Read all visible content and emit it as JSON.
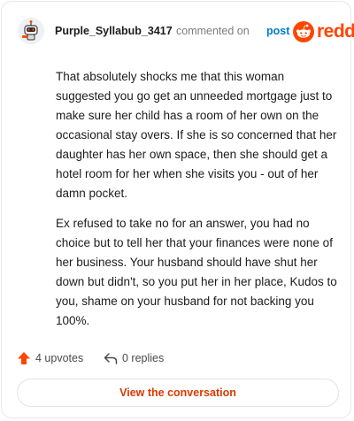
{
  "comment": {
    "username": "Purple_Syllabub_3417",
    "action_text": "commented on",
    "post_link": "post",
    "paragraphs": [
      "That absolutely shocks me that this woman suggested you go get an unneeded mortgage just to make sure her child has a room of her own on the occasional stay overs. If she is so concerned that her daughter has her own space, then she should get a hotel room for her when she visits you - out of her damn pocket.",
      "Ex refused to take no for an answer, you had no choice but to tell her that your finances were none of her business. Your husband should have shut her down but didn't, so you put her in her place, Kudos to you, shame on your husband for not backing you 100%."
    ],
    "upvotes": "4 upvotes",
    "replies": "0 replies"
  },
  "brand": {
    "logo_text": "reddit",
    "color": "#ff4500"
  },
  "footer": {
    "button_label": "View the conversation"
  },
  "icons": {
    "avatar": "robot-avatar-icon",
    "logo": "reddit-snoo-icon",
    "upvote": "upvote-arrow-icon",
    "reply": "reply-arrow-icon"
  }
}
